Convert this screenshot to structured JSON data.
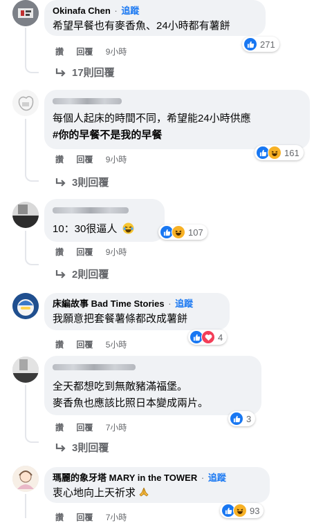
{
  "comments": [
    {
      "name": "Okinafa Chen",
      "follow": "追蹤",
      "text": "希望早餐也有麥香魚、24小時都有薯餅",
      "actions": {
        "like": "讚",
        "reply": "回覆",
        "time": "9小時"
      },
      "reactions": {
        "types": [
          "like"
        ],
        "count": "271"
      },
      "replies_label": "17則回覆"
    },
    {
      "name": "",
      "text_lines": [
        "每個人起床的時間不同，希望能24小時供應"
      ],
      "hashtag": "#你的早餐不是我的早餐",
      "actions": {
        "like": "讚",
        "reply": "回覆",
        "time": "9小時"
      },
      "reactions": {
        "types": [
          "like",
          "haha"
        ],
        "count": "161"
      },
      "replies_label": "3則回覆"
    },
    {
      "name": "",
      "text": "10：30很逼人",
      "emoji": "laughing-emoji",
      "actions": {
        "like": "讚",
        "reply": "回覆",
        "time": "9小時"
      },
      "reactions": {
        "types": [
          "like",
          "haha"
        ],
        "count": "107"
      },
      "replies_label": "2則回覆"
    },
    {
      "name": "床編故事 Bad Time Stories",
      "follow": "追蹤",
      "text": "我願意把套餐薯條都改成薯餅",
      "actions": {
        "like": "讚",
        "reply": "回覆",
        "time": "5小時"
      },
      "reactions": {
        "types": [
          "like",
          "love"
        ],
        "count": "4"
      }
    },
    {
      "name": "",
      "text_lines": [
        "全天都想吃到無敵豬滿福堡。",
        "麥香魚也應該比照日本變成兩片。"
      ],
      "actions": {
        "like": "讚",
        "reply": "回覆",
        "time": "7小時"
      },
      "reactions": {
        "types": [
          "like"
        ],
        "count": "3"
      },
      "replies_label": "3則回覆"
    },
    {
      "name": "瑪麗的象牙塔 MARY in the TOWER",
      "follow": "追蹤",
      "text": "衷心地向上天祈求",
      "emoji": "praying-hands-emoji",
      "actions": {
        "like": "讚",
        "reply": "回覆",
        "time": "7小時"
      },
      "reactions": {
        "types": [
          "like",
          "haha"
        ],
        "count": "93"
      }
    }
  ],
  "colors": {
    "link": "#1877f2",
    "bubble": "#f0f2f5",
    "muted": "#65676b",
    "like": "#1877f2",
    "haha": "#f7b125",
    "love": "#f33e58"
  }
}
